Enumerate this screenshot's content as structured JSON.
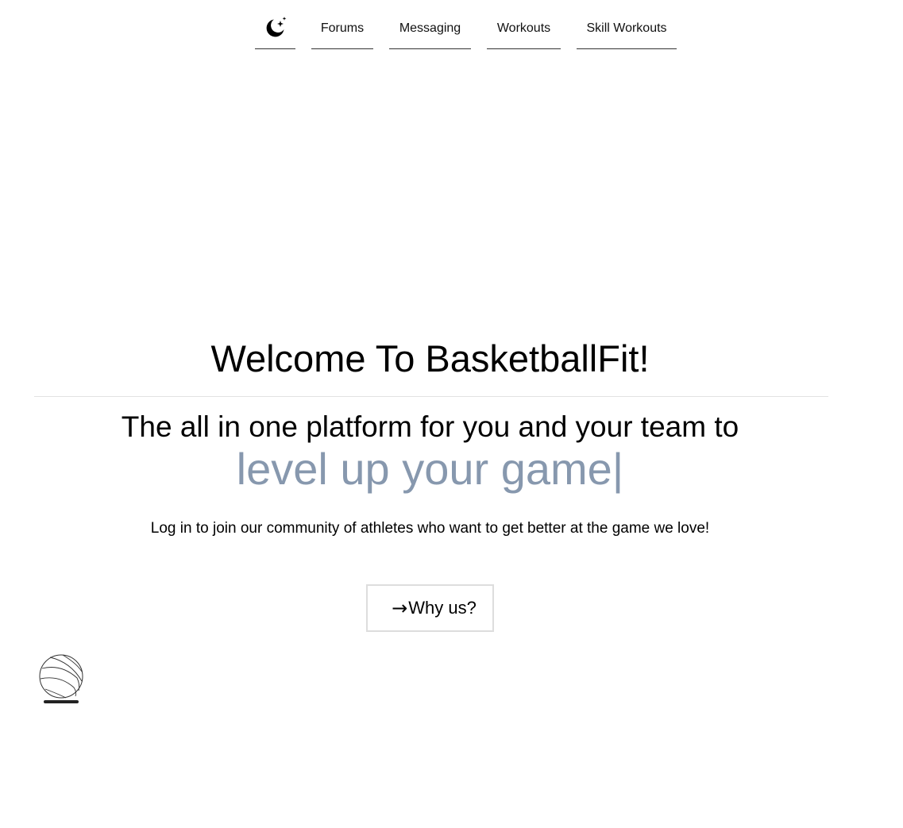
{
  "nav": {
    "theme_toggle_icon": "moon-stars-icon",
    "items": [
      {
        "label": "Forums"
      },
      {
        "label": "Messaging"
      },
      {
        "label": "Workouts"
      },
      {
        "label": "Skill Workouts"
      }
    ]
  },
  "hero": {
    "title": "Welcome To BasketballFit!",
    "tagline": "The all in one platform for you and your team to",
    "highlight": "level up your game",
    "cursor": "|",
    "intro": "Log in to join our community of athletes who want to get better at the game we love!",
    "cta": {
      "arrow": "→",
      "label": "Why us?"
    }
  },
  "footer": {
    "logo_icon": "basketball-icon"
  },
  "colors": {
    "highlight": "#8798ae",
    "divider": "#e2e2e2",
    "button_border": "#dddddd"
  }
}
